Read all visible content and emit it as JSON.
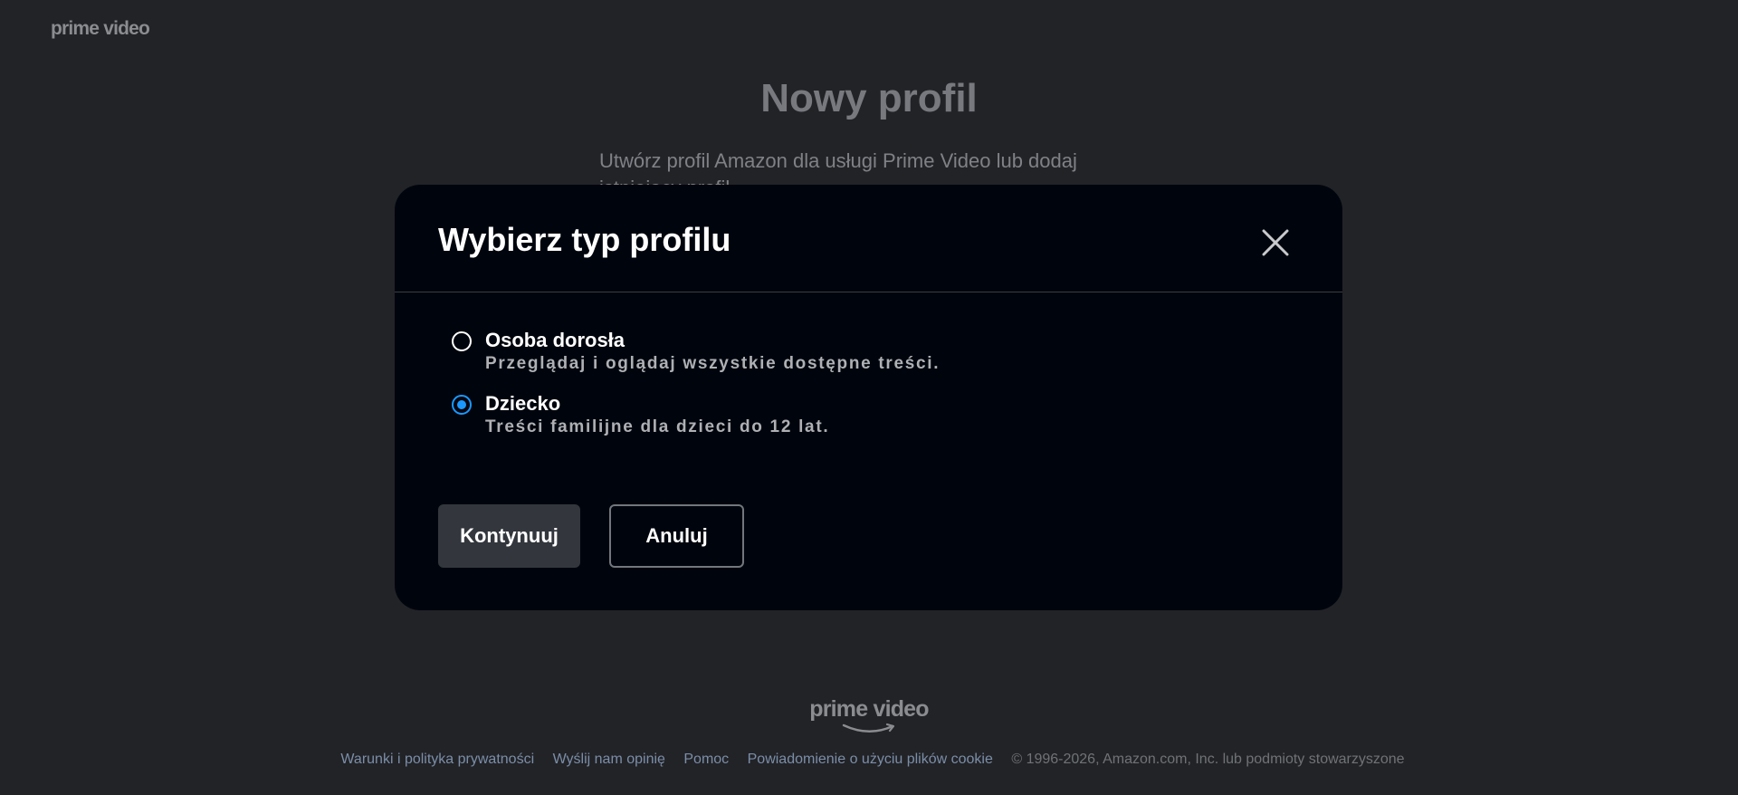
{
  "header": {
    "logo": "prime video"
  },
  "background": {
    "title": "Nowy profil",
    "subtitle": "Utwórz profil Amazon dla usługi Prime Video lub dodaj istniejący profil."
  },
  "modal": {
    "title": "Wybierz typ profilu",
    "close_icon": "close-icon",
    "options": [
      {
        "label": "Osoba dorosła",
        "description": "Przeglądaj i oglądaj wszystkie dostępne treści.",
        "selected": false
      },
      {
        "label": "Dziecko",
        "description": "Treści familijne dla dzieci do 12 lat.",
        "selected": true
      }
    ],
    "continue_label": "Kontynuuj",
    "cancel_label": "Anuluj"
  },
  "footer": {
    "logo": "prime video",
    "links": [
      "Warunki i polityka prywatności",
      "Wyślij nam opinię",
      "Pomoc",
      "Powiadomienie o użyciu plików cookie"
    ],
    "copyright": "© 1996-2026, Amazon.com, Inc. lub podmioty stowarzyszone"
  },
  "colors": {
    "page_background": "#222327",
    "modal_background": "#00050d",
    "accent": "#1a98ff",
    "link": "#7b8ea8"
  }
}
